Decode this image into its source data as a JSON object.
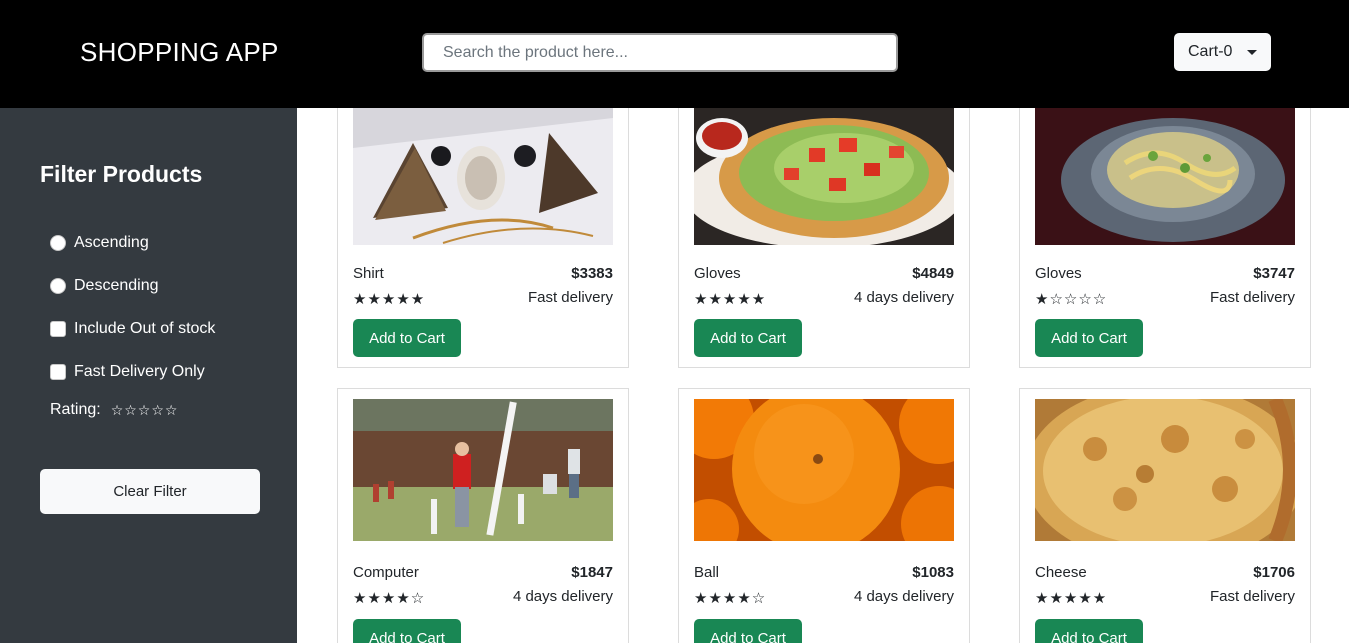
{
  "header": {
    "title": "SHOPPING APP",
    "search_placeholder": "Search the product here...",
    "search_value": "",
    "cart_label": "Cart-0"
  },
  "sidebar": {
    "title": "Filter Products",
    "options": {
      "ascending": "Ascending",
      "descending": "Descending",
      "out_of_stock": "Include Out of stock",
      "fast_delivery": "Fast Delivery Only"
    },
    "rating_label": "Rating:",
    "rating_value": 0,
    "clear_label": "Clear Filter"
  },
  "products": [
    {
      "name": "Shirt",
      "price": "$3383",
      "rating": 5,
      "delivery": "Fast delivery",
      "button": "Add to Cart"
    },
    {
      "name": "Gloves",
      "price": "$4849",
      "rating": 5,
      "delivery": "4 days delivery",
      "button": "Add to Cart"
    },
    {
      "name": "Gloves",
      "price": "$3747",
      "rating": 1,
      "delivery": "Fast delivery",
      "button": "Add to Cart"
    },
    {
      "name": "Computer",
      "price": "$1847",
      "rating": 4,
      "delivery": "4 days delivery",
      "button": "Add to Cart"
    },
    {
      "name": "Ball",
      "price": "$1083",
      "rating": 4,
      "delivery": "4 days delivery",
      "button": "Add to Cart"
    },
    {
      "name": "Cheese",
      "price": "$1706",
      "rating": 5,
      "delivery": "Fast delivery",
      "button": "Add to Cart"
    }
  ],
  "colors": {
    "navbar": "#000000",
    "sidebar": "#343a40",
    "add_button": "#198754"
  }
}
